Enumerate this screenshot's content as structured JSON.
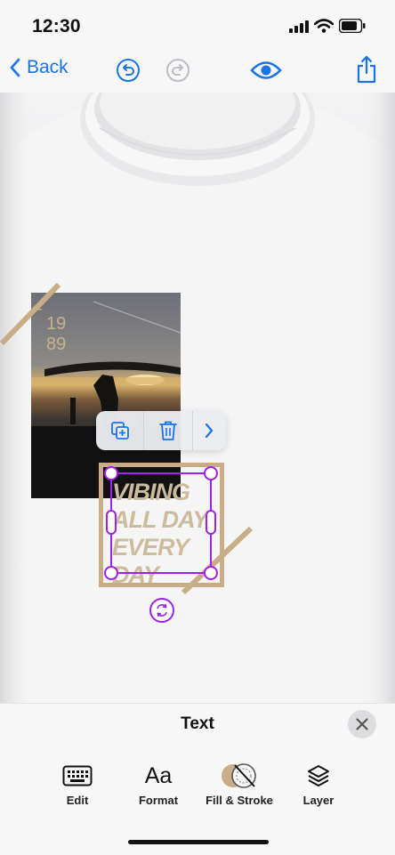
{
  "status": {
    "time": "12:30"
  },
  "nav": {
    "back_label": "Back"
  },
  "photo": {
    "dash": "–",
    "year_line1": "19",
    "year_line2": "89"
  },
  "design_text": {
    "line1": "VIBING",
    "line2": "ALL DAY",
    "line3": "EVERY",
    "line4": "DAY"
  },
  "panel": {
    "title": "Text",
    "tools": [
      {
        "label": "Edit",
        "icon": "keyboard-icon"
      },
      {
        "label": "Format",
        "icon": "Aa"
      },
      {
        "label": "Fill & Stroke",
        "icon": "fill-stroke-icon"
      },
      {
        "label": "Layer",
        "icon": "layers-icon"
      }
    ]
  },
  "colors": {
    "accent": "#1a73e8",
    "selection": "#a020f0",
    "tan": "#c8ad86"
  }
}
